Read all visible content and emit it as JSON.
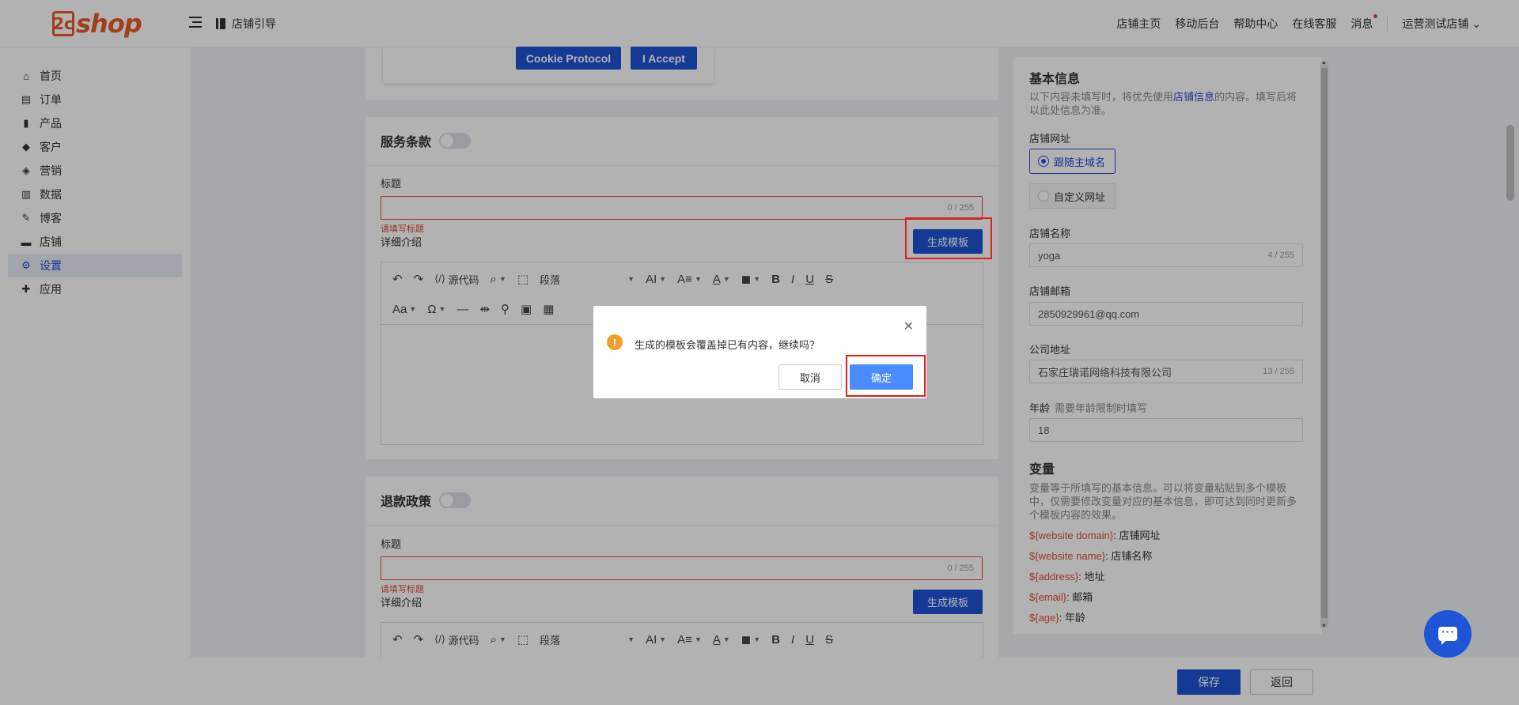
{
  "header": {
    "logo_text": "shop",
    "guide_label": "店铺引导",
    "links": [
      "店铺主页",
      "移动后台",
      "帮助中心",
      "在线客服",
      "消息"
    ],
    "store_name": "运营测试店铺"
  },
  "sidebar": {
    "items": [
      {
        "label": "首页",
        "icon": "home-icon",
        "glyph": "⌂"
      },
      {
        "label": "订单",
        "icon": "clipboard-icon",
        "glyph": "▤"
      },
      {
        "label": "产品",
        "icon": "bag-icon",
        "glyph": "▮"
      },
      {
        "label": "客户",
        "icon": "diamond-icon",
        "glyph": "◆"
      },
      {
        "label": "营销",
        "icon": "tag-icon",
        "glyph": "◈"
      },
      {
        "label": "数据",
        "icon": "bar-chart-icon",
        "glyph": "▥"
      },
      {
        "label": "博客",
        "icon": "edit-icon",
        "glyph": "✎"
      },
      {
        "label": "店铺",
        "icon": "store-icon",
        "glyph": "▬"
      },
      {
        "label": "设置",
        "icon": "gear-icon",
        "glyph": "⚙"
      },
      {
        "label": "应用",
        "icon": "puzzle-icon",
        "glyph": "✚"
      }
    ],
    "active_index": 8
  },
  "cookie_bar": {
    "protocol_label": "Cookie Protocol",
    "accept_label": "I Accept"
  },
  "terms_section": {
    "title": "服务条款",
    "title_label": "标题",
    "counter": "0 / 255",
    "error": "请填写标题",
    "detail_label": "详细介绍",
    "generate_label": "生成模板"
  },
  "refund_section": {
    "title": "退款政策",
    "title_label": "标题",
    "counter": "0 / 255",
    "error": "请填写标题",
    "detail_label": "详细介绍",
    "generate_label": "生成模板"
  },
  "editor_toolbar": {
    "source_label": "源代码",
    "paragraph_label": "段落"
  },
  "modal": {
    "message": "生成的模板会覆盖掉已有内容，继续吗？",
    "cancel_label": "取消",
    "confirm_label": "确定"
  },
  "right_panel": {
    "basic_title": "基本信息",
    "basic_desc_1": "以下内容未填写时，将优先使用",
    "basic_desc_link": "店铺信息",
    "basic_desc_2": "的内容。填写后将以此处信息为准。",
    "url_label": "店铺网址",
    "url_options": [
      "跟随主域名",
      "自定义网址"
    ],
    "url_selected": 0,
    "name_label": "店铺名称",
    "name_value": "yoga",
    "name_counter": "4 / 255",
    "email_label": "店铺邮箱",
    "email_value": "2850929961@qq.com",
    "address_label": "公司地址",
    "address_value": "石家庄瑞诺网络科技有限公司",
    "address_counter": "13 / 255",
    "age_label": "年龄",
    "age_hint": "需要年龄限制时填写",
    "age_value": "18",
    "vars_title": "变量",
    "vars_desc": "变量等于所填写的基本信息。可以将变量粘贴到多个模板中，仅需要修改变量对应的基本信息，即可达到同时更新多个模板内容的效果。",
    "vars": [
      {
        "key": "${website domain}",
        "desc": ": 店铺网址"
      },
      {
        "key": "${website name}",
        "desc": ": 店铺名称"
      },
      {
        "key": "${address}",
        "desc": ": 地址"
      },
      {
        "key": "${email}",
        "desc": ": 邮箱"
      },
      {
        "key": "${age}",
        "desc": ": 年龄"
      }
    ]
  },
  "footer": {
    "save_label": "保存",
    "back_label": "返回"
  },
  "colors": {
    "brand": "#e8592b",
    "primary": "#1e54d6",
    "confirm": "#4a8bff",
    "error": "#e04a3f",
    "highlight_box": "#e02020"
  }
}
